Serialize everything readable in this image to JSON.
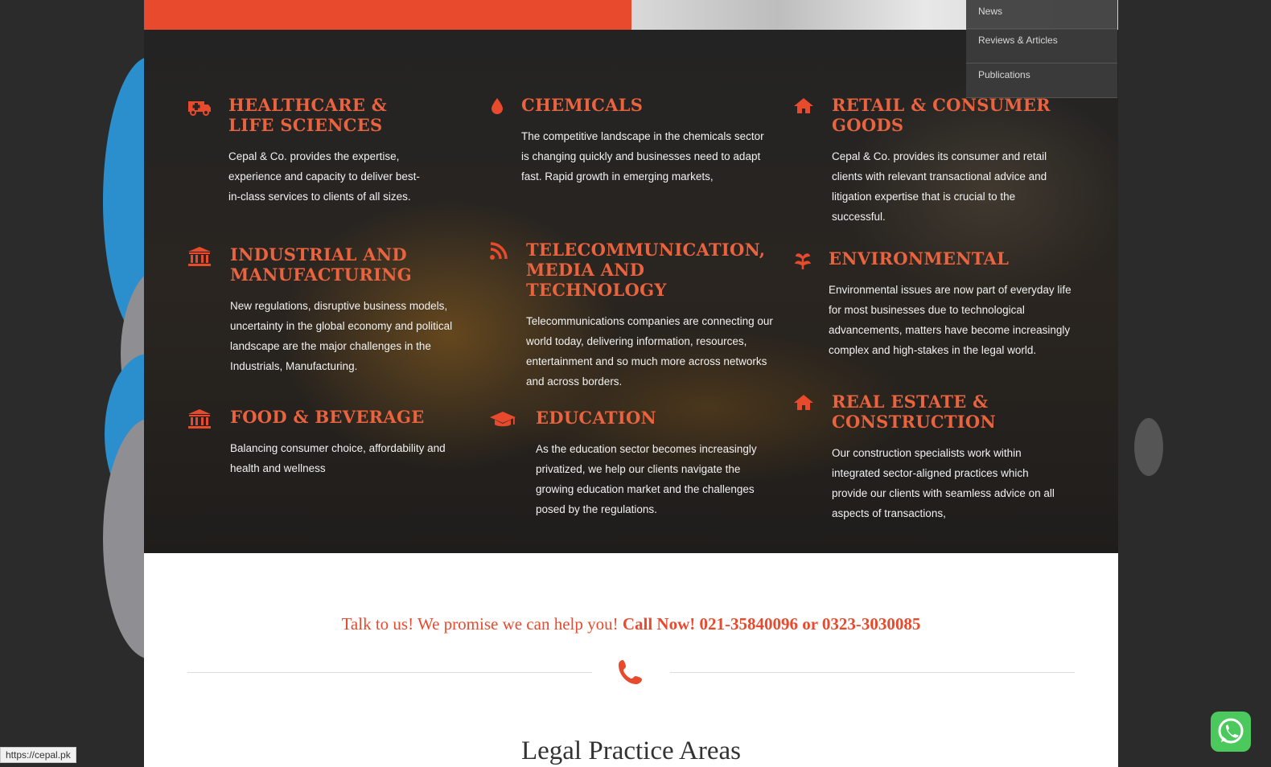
{
  "menu": {
    "items": [
      "News",
      "Reviews & Articles",
      "Publications"
    ]
  },
  "sectors": [
    {
      "icon": "ambulance-icon",
      "title": "HEALTHCARE & LIFE SCIENCES",
      "text": "Cepal & Co. provides the expertise, experience and capacity to deliver best-in-class services to clients of all sizes."
    },
    {
      "icon": "drop-icon",
      "title": "CHEMICALS",
      "text": "The competitive landscape in the chemicals sector is changing quickly and businesses need to adapt fast. Rapid growth in emerging markets,"
    },
    {
      "icon": "home-icon",
      "title": "RETAIL & CONSUMER GOODS",
      "text": "Cepal & Co. provides its consumer and retail clients with relevant transactional advice and litigation expertise that is crucial to the successful."
    },
    {
      "icon": "bank-icon",
      "title": "INDUSTRIAL AND MANUFACTURING",
      "text": "New regulations, disruptive business models, uncertainty in the global economy and political landscape are the major challenges in the Industrials, Manufacturing."
    },
    {
      "icon": "rss-icon",
      "title": "TELECOMMUNICATION, MEDIA AND TECHNOLOGY",
      "text": "Telecommunications companies are connecting our world today, delivering information, resources, entertainment and so much more across networks and across borders."
    },
    {
      "icon": "leaf-icon",
      "title": "ENVIRONMENTAL",
      "text": "Environmental issues are now part of everyday life for most businesses due to technological advancements, matters have become increasingly complex and high-stakes in the legal world."
    },
    {
      "icon": "bank-icon",
      "title": "FOOD & BEVERAGE",
      "text": "Balancing consumer choice, affordability and health and wellness"
    },
    {
      "icon": "graduation-cap-icon",
      "title": "EDUCATION",
      "text": "As the education sector becomes increasingly privatized, we help our clients navigate the growing education market and the challenges posed by the regulations."
    },
    {
      "icon": "home-icon",
      "title": "REAL ESTATE & CONSTRUCTION",
      "text": "Our construction specialists work within integrated sector-aligned practices which provide our clients with seamless advice on all aspects of transactions,"
    }
  ],
  "cta": {
    "lead": "Talk to us! We promise we can help you!",
    "call": "Call Now! 021-35840096 or 0323-3030085"
  },
  "section_title": "Legal Practice Areas",
  "status_url": "https://cepal.pk",
  "colors": {
    "accent": "#e84a2e",
    "whatsapp": "#4cc95d"
  }
}
